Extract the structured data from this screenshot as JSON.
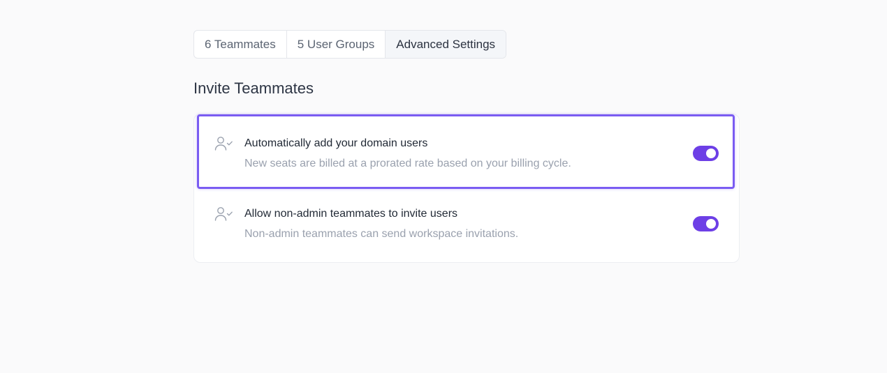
{
  "tabs": [
    {
      "label": "6 Teammates",
      "active": false
    },
    {
      "label": "5 User Groups",
      "active": false
    },
    {
      "label": "Advanced Settings",
      "active": true
    }
  ],
  "section": {
    "title": "Invite Teammates"
  },
  "settings": [
    {
      "icon": "user-check-icon",
      "title": "Automatically add your domain users",
      "description": "New seats are billed at a prorated rate based on your billing cycle.",
      "enabled": true,
      "highlighted": true
    },
    {
      "icon": "user-check-icon",
      "title": "Allow non-admin teammates to invite users",
      "description": "Non-admin teammates can send workspace invitations.",
      "enabled": true,
      "highlighted": false
    }
  ],
  "colors": {
    "accent": "#6d3fe6",
    "highlight_border": "#7a5cf2",
    "background": "#fafafb"
  }
}
